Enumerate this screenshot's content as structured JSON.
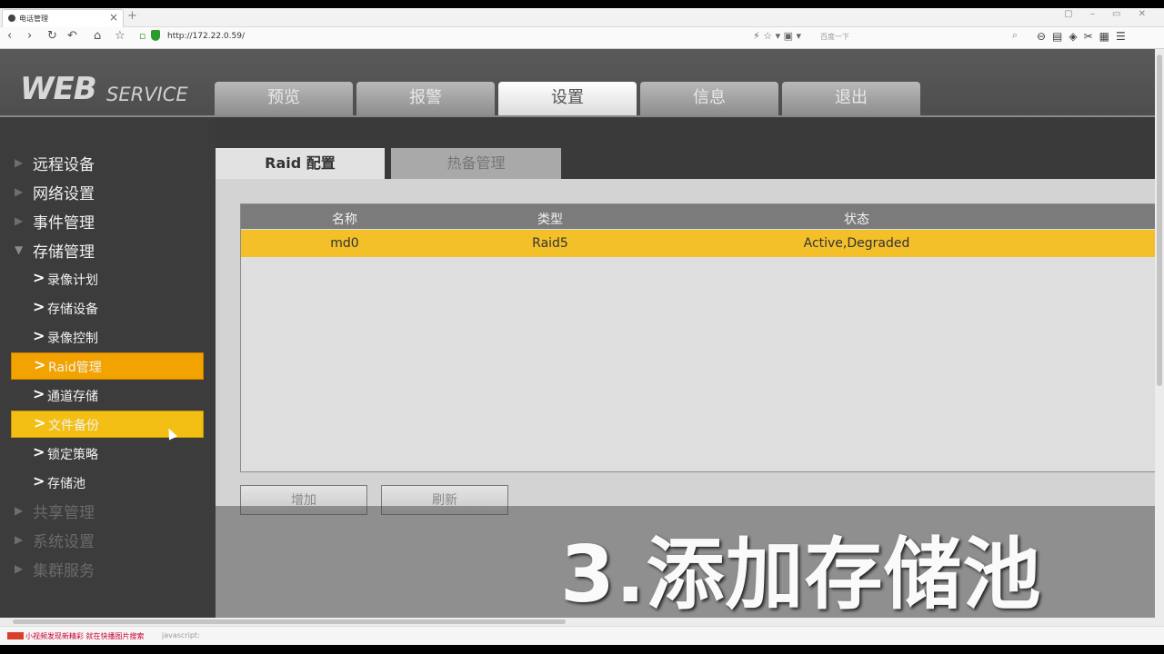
{
  "browser": {
    "tab_title": "电话管理",
    "url": "http://172.22.0.59/",
    "search_placeholder": "百度一下"
  },
  "app": {
    "logo_main": "WEB",
    "logo_sub": "SERVICE",
    "main_tabs": [
      "预览",
      "报警",
      "设置",
      "信息",
      "退出"
    ],
    "active_main_tab": "设置"
  },
  "sidebar": {
    "groups": [
      {
        "label": "远程设备"
      },
      {
        "label": "网络设置"
      },
      {
        "label": "事件管理"
      },
      {
        "label": "存储管理"
      }
    ],
    "sub_items": [
      "录像计划",
      "存储设备",
      "录像控制",
      "Raid管理",
      "通道存储",
      "文件备份",
      "锁定策略",
      "存储池"
    ],
    "lower_groups": [
      {
        "label": "共享管理"
      },
      {
        "label": "系统设置"
      },
      {
        "label": "集群服务"
      }
    ]
  },
  "content": {
    "sub_tabs": [
      "Raid 配置",
      "热备管理"
    ],
    "table": {
      "headers": [
        "名称",
        "类型",
        "状态"
      ],
      "rows": [
        [
          "md0",
          "Raid5",
          "Active,Degraded"
        ]
      ]
    },
    "buttons": {
      "add": "增加",
      "refresh": "刷新"
    }
  },
  "caption": "3.添加存储池",
  "status_bar": {
    "text1": "小视频发现新精彩 就在快播图片搜索",
    "text2": "javascript:"
  }
}
